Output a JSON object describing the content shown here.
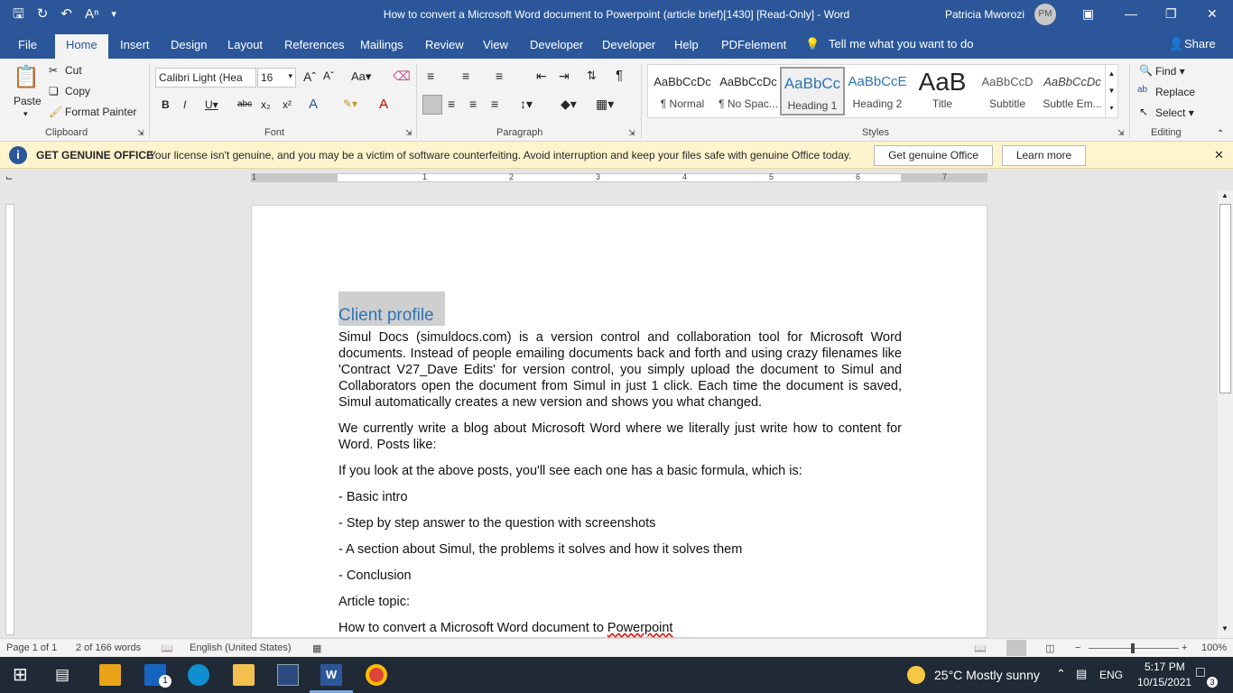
{
  "window": {
    "title": "How to convert a Microsoft Word document to Powerpoint (article brief)[1430] [Read-Only]  -  Word",
    "user_name": "Patricia Mworozi",
    "user_initials": "PM"
  },
  "tabs": [
    "File",
    "Home",
    "Insert",
    "Design",
    "Layout",
    "References",
    "Mailings",
    "Review",
    "View",
    "Developer",
    "Developer",
    "Help",
    "PDFelement"
  ],
  "tell_me": "Tell me what you want to do",
  "share": "Share",
  "clipboard": {
    "paste": "Paste",
    "cut": "Cut",
    "copy": "Copy",
    "format_painter": "Format Painter",
    "label": "Clipboard"
  },
  "font": {
    "name": "Calibri Light (Hea",
    "size": "16",
    "label": "Font"
  },
  "paragraph": {
    "label": "Paragraph"
  },
  "styles": {
    "label": "Styles",
    "items": [
      {
        "preview": "AaBbCcDc",
        "name": "¶ Normal"
      },
      {
        "preview": "AaBbCcDc",
        "name": "¶ No Spac..."
      },
      {
        "preview": "AaBbCc",
        "name": "Heading 1"
      },
      {
        "preview": "AaBbCcE",
        "name": "Heading 2"
      },
      {
        "preview": "AaB",
        "name": "Title"
      },
      {
        "preview": "AaBbCcD",
        "name": "Subtitle"
      },
      {
        "preview": "AaBbCcDc",
        "name": "Subtle Em..."
      }
    ]
  },
  "editing": {
    "find": "Find",
    "replace": "Replace",
    "select": "Select",
    "label": "Editing"
  },
  "notice": {
    "heading": "GET GENUINE OFFICE",
    "message": "Your license isn't genuine, and you may be a victim of software counterfeiting. Avoid interruption and keep your files safe with genuine Office today.",
    "button1": "Get genuine Office",
    "button2": "Learn more"
  },
  "ruler_numbers": [
    "1",
    "1",
    "2",
    "3",
    "4",
    "5",
    "6",
    "7"
  ],
  "document": {
    "heading": "Client profile",
    "paragraphs": [
      "Simul Docs (simuldocs.com) is a version control and collaboration tool for Microsoft Word documents. Instead of people emailing documents back and forth and using crazy filenames like 'Contract V27_Dave Edits' for version control, you simply upload the document to Simul and Collaborators open the document from Simul in just 1 click. Each time the document is saved, Simul automatically creates a new version and shows you what changed.",
      "We currently write a blog about Microsoft Word where we literally just write how to content for Word. Posts like:",
      "If you look at the above posts, you'll see each one has a basic formula, which is:",
      "- Basic intro",
      "- Step by step answer to the question with screenshots",
      "- A section about Simul, the problems it solves and how it solves them",
      "- Conclusion",
      "Article topic:"
    ],
    "last_line_prefix": "How to convert a Microsoft Word document to ",
    "last_line_word": "Powerpoint"
  },
  "status": {
    "page": "Page 1 of 1",
    "words": "2 of 166 words",
    "language": "English (United States)",
    "zoom": "100%"
  },
  "taskbar": {
    "weather": "25°C  Mostly sunny",
    "lang": "ENG",
    "time": "5:17 PM",
    "date": "10/15/2021",
    "notif_count": "3",
    "mail_badge": "1"
  }
}
